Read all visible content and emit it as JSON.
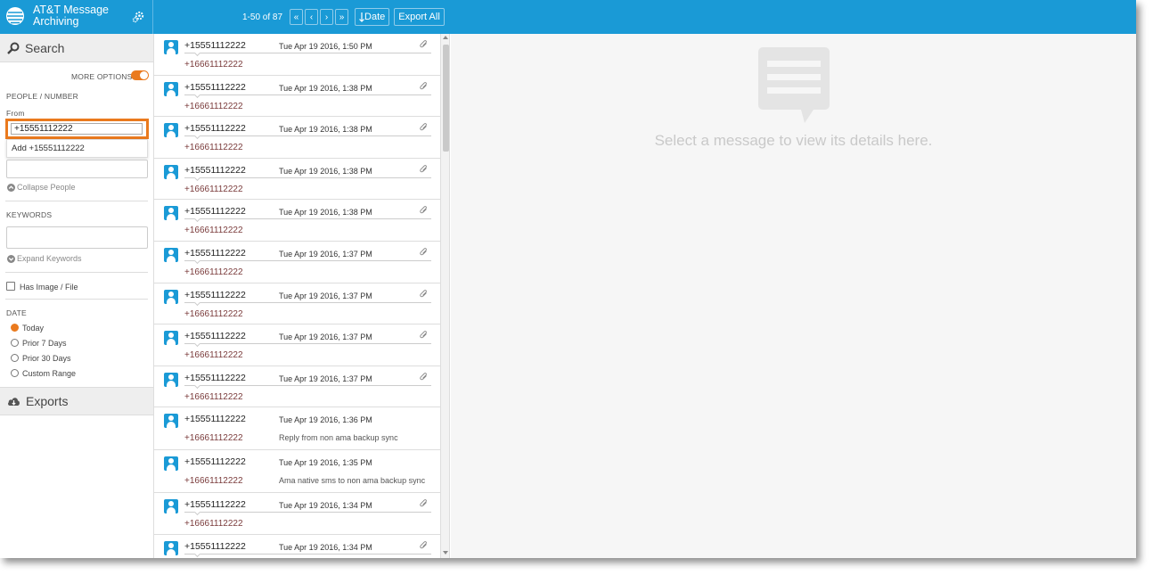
{
  "app": {
    "title": "AT&T Message Archiving"
  },
  "toolbar": {
    "count": "1-50 of 87",
    "first": "«",
    "prev": "‹",
    "next": "›",
    "last": "»",
    "sort_label": "Date",
    "export_label": "Export All"
  },
  "search": {
    "title": "Search",
    "more_options": "MORE OPTIONS",
    "more_options_on": true,
    "people_label": "PEOPLE / NUMBER",
    "from_label": "From",
    "from_value": "+15551112222",
    "suggestion": "Add +15551112222",
    "collapse_people": "Collapse People",
    "keywords_label": "KEYWORDS",
    "expand_keywords": "Expand Keywords",
    "has_file": "Has Image / File",
    "date_label": "DATE",
    "date_options": [
      "Today",
      "Prior 7 Days",
      "Prior 30 Days",
      "Custom Range"
    ],
    "date_selected": "Today"
  },
  "exports": {
    "title": "Exports"
  },
  "messages": [
    {
      "from": "+15551112222",
      "date": "Tue Apr 19 2016, 1:50 PM",
      "to": "+16661112222",
      "preview": "",
      "attachment": true
    },
    {
      "from": "+15551112222",
      "date": "Tue Apr 19 2016, 1:38 PM",
      "to": "+16661112222",
      "preview": "",
      "attachment": true
    },
    {
      "from": "+15551112222",
      "date": "Tue Apr 19 2016, 1:38 PM",
      "to": "+16661112222",
      "preview": "",
      "attachment": true
    },
    {
      "from": "+15551112222",
      "date": "Tue Apr 19 2016, 1:38 PM",
      "to": "+16661112222",
      "preview": "",
      "attachment": true
    },
    {
      "from": "+15551112222",
      "date": "Tue Apr 19 2016, 1:38 PM",
      "to": "+16661112222",
      "preview": "",
      "attachment": true
    },
    {
      "from": "+15551112222",
      "date": "Tue Apr 19 2016, 1:37 PM",
      "to": "+16661112222",
      "preview": "",
      "attachment": true
    },
    {
      "from": "+15551112222",
      "date": "Tue Apr 19 2016, 1:37 PM",
      "to": "+16661112222",
      "preview": "",
      "attachment": true
    },
    {
      "from": "+15551112222",
      "date": "Tue Apr 19 2016, 1:37 PM",
      "to": "+16661112222",
      "preview": "",
      "attachment": true
    },
    {
      "from": "+15551112222",
      "date": "Tue Apr 19 2016, 1:37 PM",
      "to": "+16661112222",
      "preview": "",
      "attachment": true
    },
    {
      "from": "+15551112222",
      "date": "Tue Apr 19 2016, 1:36 PM",
      "to": "+16661112222",
      "preview": "Reply from non ama backup sync",
      "attachment": false
    },
    {
      "from": "+15551112222",
      "date": "Tue Apr 19 2016, 1:35 PM",
      "to": "+16661112222",
      "preview": "Ama native sms to non ama backup sync",
      "attachment": false
    },
    {
      "from": "+15551112222",
      "date": "Tue Apr 19 2016, 1:34 PM",
      "to": "+16661112222",
      "preview": "",
      "attachment": true
    },
    {
      "from": "+15551112222",
      "date": "Tue Apr 19 2016, 1:34 PM",
      "to": "",
      "preview": "",
      "attachment": true
    }
  ],
  "detail": {
    "hint": "Select a message to view its details here."
  },
  "colors": {
    "brand_blue": "#1a9ad6",
    "accent_orange": "#ea7a1e"
  }
}
